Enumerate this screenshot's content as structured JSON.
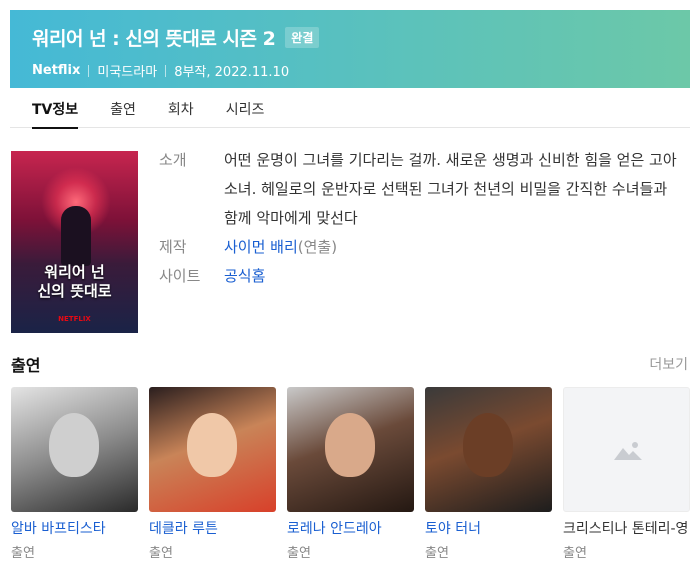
{
  "header": {
    "title": "워리어 넌 : 신의 뜻대로 시즌 2",
    "badge": "완결",
    "network": "Netflix",
    "genre": "미국드라마",
    "episodes_date": "8부작, 2022.11.10"
  },
  "tabs": [
    {
      "label": "TV정보",
      "active": true
    },
    {
      "label": "출연",
      "active": false
    },
    {
      "label": "회차",
      "active": false
    },
    {
      "label": "시리즈",
      "active": false
    }
  ],
  "poster": {
    "title_line1": "워리어 넌",
    "title_line2": "신의 뜻대로",
    "brand": "NETFLIX"
  },
  "info": {
    "intro_label": "소개",
    "intro_text": "어떤 운명이 그녀를 기다리는 걸까. 새로운 생명과 신비한 힘을 얻은 고아 소녀. 헤일로의 운반자로 선택된 그녀가 천년의 비밀을 간직한 수녀들과 함께 악마에게 맞선다",
    "production_label": "제작",
    "producer_name": "사이먼 배리",
    "producer_role": "(연출)",
    "site_label": "사이트",
    "site_link": "공식홈"
  },
  "cast": {
    "heading": "출연",
    "more": "더보기",
    "members": [
      {
        "name": "알바 바프티스타",
        "role": "출연"
      },
      {
        "name": "데클라 루튼",
        "role": "출연"
      },
      {
        "name": "로레나 안드레아",
        "role": "출연"
      },
      {
        "name": "토야 터너",
        "role": "출연"
      },
      {
        "name": "크리스티나 톤테리-영",
        "role": "출연"
      }
    ]
  }
}
